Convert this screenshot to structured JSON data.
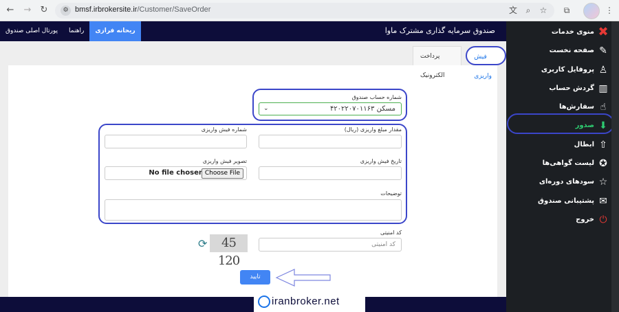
{
  "browser": {
    "url_domain": "bmsf.irbrokersite.ir",
    "url_path": "/Customer/SaveOrder"
  },
  "topbar": {
    "title": "صندوق سرمایه گذاری مشترک ماوا",
    "tabs": [
      {
        "label": "ریحانه فرازی",
        "active": true
      },
      {
        "label": "راهنما",
        "active": false
      },
      {
        "label": "پورتال اصلی صندوق",
        "active": false
      }
    ]
  },
  "form_tabs": [
    {
      "label": "فیش واریزی",
      "active": true
    },
    {
      "label": "پرداخت الکترونیک",
      "active": false
    }
  ],
  "form": {
    "account_label": "شماره حساب صندوق",
    "account_value": "۴۲۰۲۲۰۷۰۱۱۶۳ مسکن",
    "amount_label": "مقدار مبلغ واریزی (ریال)",
    "receipt_number_label": "شماره فیش واریزی",
    "receipt_date_label": "تاریخ فیش واریزی",
    "receipt_image_label": "تصویر فیش واریزی",
    "file_status": "No file chosen",
    "file_button": "Choose File",
    "description_label": "توضیحات",
    "security_code_label": "کد امنیتی",
    "security_code_placeholder": "کد امنیتی",
    "captcha_text": "45 120",
    "submit_label": "تایید"
  },
  "sidebar": {
    "items": [
      {
        "label": "منوی خدمات",
        "icon": "close-icon",
        "active": false
      },
      {
        "label": "صفحه نخست",
        "icon": "home-ticket-icon",
        "active": false
      },
      {
        "label": "پروفایل کاربری",
        "icon": "user-icon",
        "active": false
      },
      {
        "label": "گردش حساب",
        "icon": "bar-chart-icon",
        "active": false
      },
      {
        "label": "سفارش‌ها",
        "icon": "hand-icon",
        "active": false
      },
      {
        "label": "صدور",
        "icon": "arrow-down-icon",
        "active": true
      },
      {
        "label": "ابطال",
        "icon": "arrow-up-icon",
        "active": false
      },
      {
        "label": "لیست گواهی‌ها",
        "icon": "certificate-icon",
        "active": false
      },
      {
        "label": "سودهای دوره‌ای",
        "icon": "star-icon",
        "active": false
      },
      {
        "label": "پشتیبانی صندوق",
        "icon": "mail-icon",
        "active": false
      },
      {
        "label": "خروج",
        "icon": "power-icon",
        "active": false
      }
    ]
  },
  "watermark": {
    "text": "iranbroker.net"
  },
  "colors": {
    "topbar_bg": "#0d0d3a",
    "sidebar_bg": "#1c1f23",
    "accent": "#4285f4",
    "active_green": "#2ecc71",
    "annotation": "#3b46c9"
  }
}
